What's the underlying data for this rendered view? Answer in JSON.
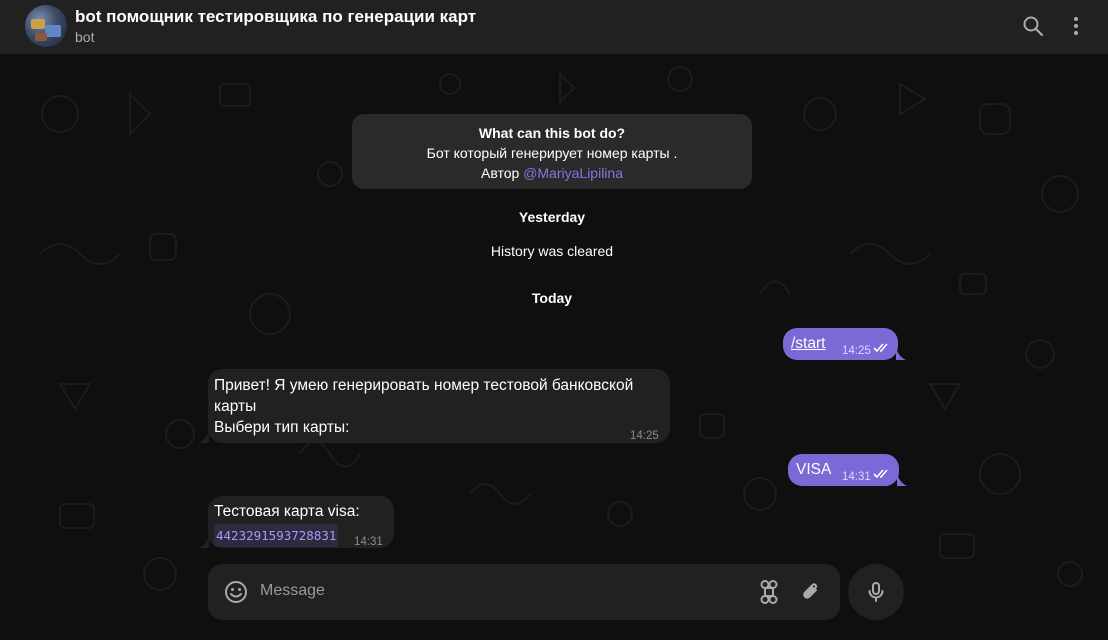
{
  "header": {
    "title": "bot помощник тестировщика по генерации карт",
    "subtitle": "bot",
    "search_icon": "search-icon",
    "menu_icon": "more-vertical-icon"
  },
  "info_card": {
    "heading": "What can this bot do?",
    "line1": "Бот который генерирует номер карты .",
    "line2_prefix": "Автор ",
    "line2_link": "@MariyaLipilina"
  },
  "service": {
    "yesterday": "Yesterday",
    "history_cleared": "History was cleared",
    "today": "Today"
  },
  "messages": [
    {
      "direction": "out",
      "text": "/start",
      "time": "14:25",
      "status": "read"
    },
    {
      "direction": "in",
      "lines": [
        "Привет! Я умею генерировать номер тестовой банковской",
        "карты",
        "Выбери тип карты:"
      ],
      "time": "14:25"
    },
    {
      "direction": "out",
      "text": "VISA",
      "time": "14:31",
      "status": "read"
    },
    {
      "direction": "in",
      "text": "Тестовая карта visa:",
      "code": "4423291593728831",
      "time": "14:31"
    }
  ],
  "composer": {
    "placeholder": "Message",
    "emoji_icon": "smile-icon",
    "commands_icon": "command-icon",
    "attach_icon": "paperclip-icon",
    "mic_icon": "microphone-icon"
  },
  "colors": {
    "accent": "#8774e1",
    "outgoing_bubble": "#7b69d6",
    "incoming_bubble": "#212121",
    "header_bg": "#212121"
  }
}
